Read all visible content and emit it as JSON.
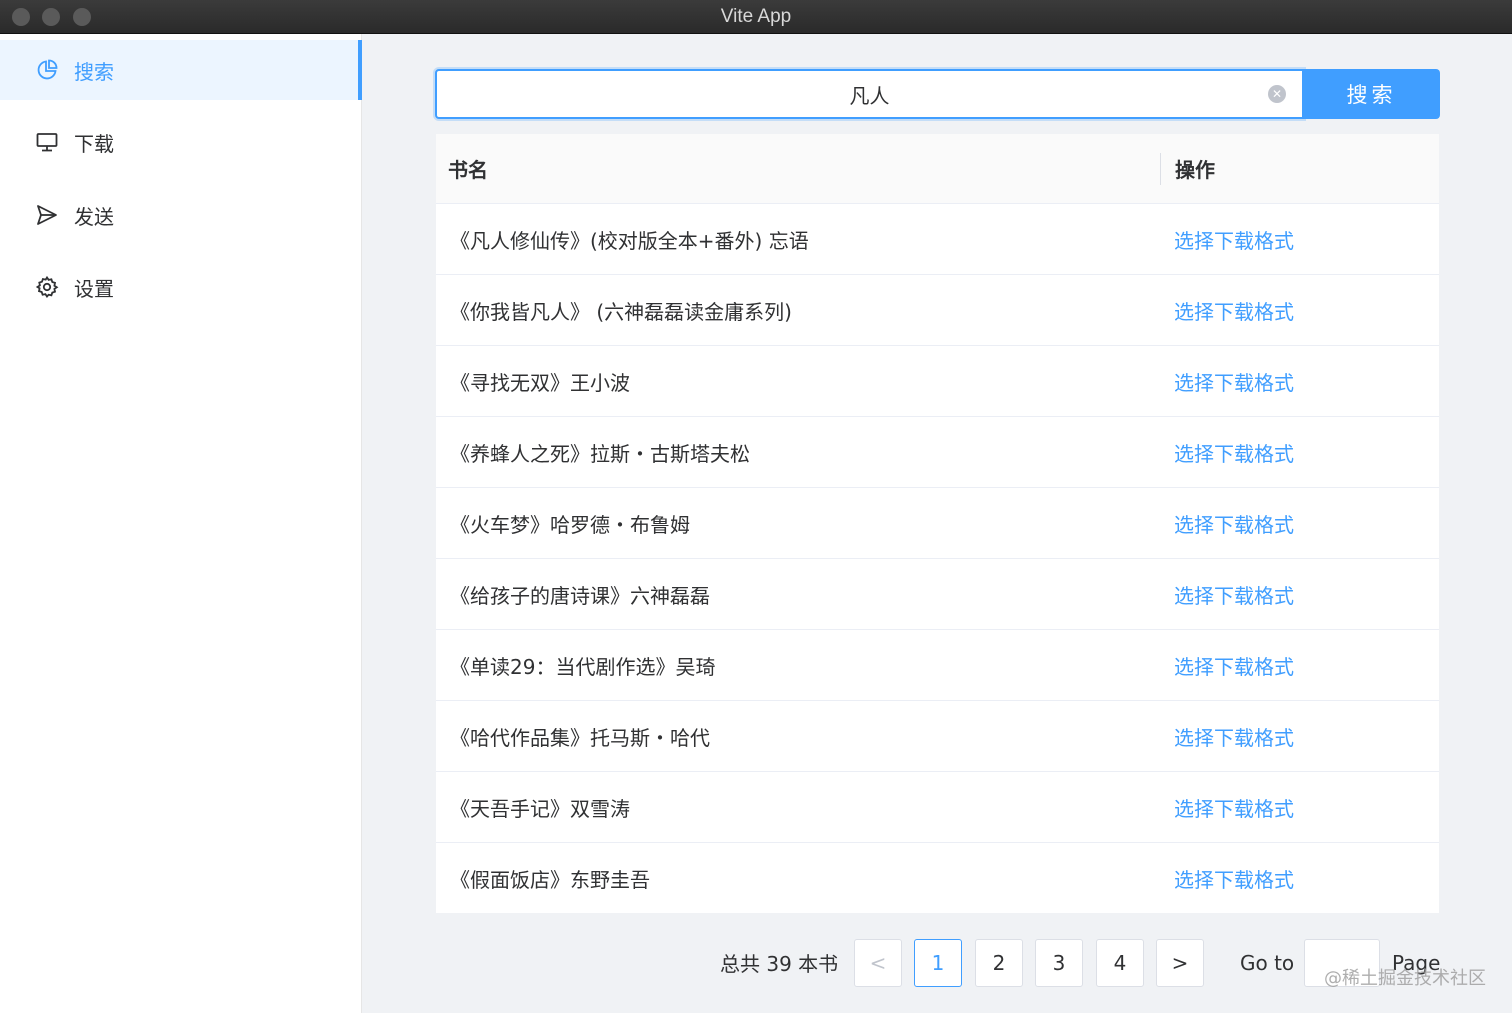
{
  "window": {
    "title": "Vite App"
  },
  "sidebar": {
    "items": [
      {
        "label": "搜索",
        "icon": "pie-chart-icon",
        "active": true
      },
      {
        "label": "下载",
        "icon": "monitor-icon",
        "active": false
      },
      {
        "label": "发送",
        "icon": "send-icon",
        "active": false
      },
      {
        "label": "设置",
        "icon": "gear-icon",
        "active": false
      }
    ]
  },
  "search": {
    "value": "凡人",
    "button_label": "搜索"
  },
  "table": {
    "headers": {
      "name": "书名",
      "operation": "操作"
    },
    "rows": [
      {
        "name": "《凡人修仙传》(校对版全本+番外) 忘语",
        "action": "选择下载格式"
      },
      {
        "name": "《你我皆凡人》 (六神磊磊读金庸系列)",
        "action": "选择下载格式"
      },
      {
        "name": "《寻找无双》王小波",
        "action": "选择下载格式"
      },
      {
        "name": "《养蜂人之死》拉斯・古斯塔夫松",
        "action": "选择下载格式"
      },
      {
        "name": "《火车梦》哈罗德・布鲁姆",
        "action": "选择下载格式"
      },
      {
        "name": "《给孩子的唐诗课》六神磊磊",
        "action": "选择下载格式"
      },
      {
        "name": "《单读29：当代剧作选》吴琦",
        "action": "选择下载格式"
      },
      {
        "name": "《哈代作品集》托马斯・哈代",
        "action": "选择下载格式"
      },
      {
        "name": "《天吾手记》双雪涛",
        "action": "选择下载格式"
      },
      {
        "name": "《假面饭店》东野圭吾",
        "action": "选择下载格式"
      }
    ]
  },
  "pagination": {
    "total_text": "总共 39 本书",
    "prev": "<",
    "next": ">",
    "pages": [
      "1",
      "2",
      "3",
      "4"
    ],
    "current_page": "1",
    "goto_label": "Go to",
    "goto_value": "",
    "page_label": "Page"
  },
  "watermark": "@稀土掘金技术社区",
  "colors": {
    "accent": "#409eff",
    "active_bg": "#ecf5ff",
    "background": "#f0f2f5"
  }
}
